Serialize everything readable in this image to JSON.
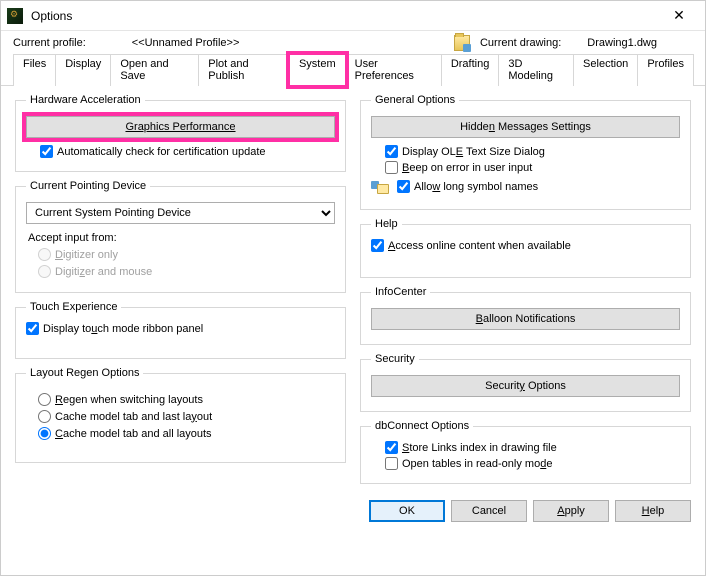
{
  "window": {
    "title": "Options"
  },
  "header": {
    "profile_label": "Current profile:",
    "profile_value": "<<Unnamed Profile>>",
    "drawing_label": "Current drawing:",
    "drawing_value": "Drawing1.dwg"
  },
  "tabs": {
    "files": "Files",
    "display": "Display",
    "open_save": "Open and Save",
    "plot_publish": "Plot and Publish",
    "system": "System",
    "user_prefs": "User Preferences",
    "drafting": "Drafting",
    "modeling": "3D Modeling",
    "selection": "Selection",
    "profiles": "Profiles"
  },
  "hw_accel": {
    "legend": "Hardware Acceleration",
    "graphics_btn": "Graphics Performance",
    "auto_check": "Automatically check for certification update"
  },
  "pointing": {
    "legend": "Current Pointing Device",
    "selected": "Current System Pointing Device",
    "accept_label": "Accept input from:",
    "digitizer_only": "Digitizer only",
    "digitizer_mouse": "Digitizer and mouse"
  },
  "touch": {
    "legend": "Touch Experience",
    "panel": "Display touch mode ribbon panel"
  },
  "regen": {
    "legend": "Layout Regen Options",
    "r1": "Regen when switching layouts",
    "r2": "Cache model tab and last layout",
    "r3": "Cache model tab and all layouts"
  },
  "general": {
    "legend": "General Options",
    "hidden_btn": "Hidden Messages Settings",
    "ole": "Display OLE Text Size Dialog",
    "beep": "Beep on error in user input",
    "long_names": "Allow long symbol names"
  },
  "help": {
    "legend": "Help",
    "access": "Access online content when available"
  },
  "infocenter": {
    "legend": "InfoCenter",
    "balloon_btn": "Balloon Notifications"
  },
  "security": {
    "legend": "Security",
    "btn": "Security Options"
  },
  "dbconnect": {
    "legend": "dbConnect Options",
    "store": "Store Links index in drawing file",
    "readonly": "Open tables in read-only mode"
  },
  "buttons": {
    "ok": "OK",
    "cancel": "Cancel",
    "apply": "Apply",
    "help": "Help"
  }
}
